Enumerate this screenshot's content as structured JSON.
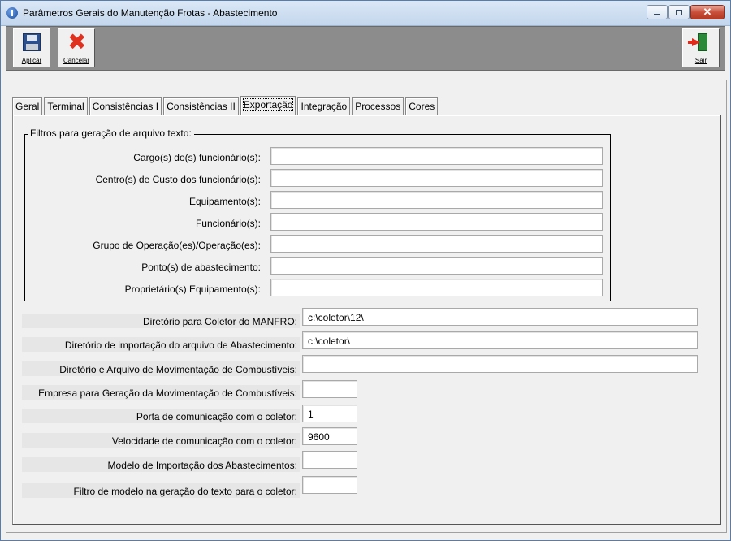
{
  "window": {
    "title": "Parâmetros Gerais do Manutenção Frotas - Abastecimento"
  },
  "toolbar": {
    "apply_label": "Aplicar",
    "cancel_label": "Cancelar",
    "exit_label": "Sair"
  },
  "tabs": [
    {
      "label": "Geral"
    },
    {
      "label": "Terminal"
    },
    {
      "label": "Consistências I"
    },
    {
      "label": "Consistências II"
    },
    {
      "label": "Exportação"
    },
    {
      "label": "Integração"
    },
    {
      "label": "Processos"
    },
    {
      "label": "Cores"
    }
  ],
  "active_tab": "Exportação",
  "filters": {
    "caption": "Filtros para geração de arquivo texto:",
    "rows": [
      {
        "label": "Cargo(s) do(s) funcionário(s):",
        "value": ""
      },
      {
        "label": "Centro(s) de Custo dos funcionário(s):",
        "value": ""
      },
      {
        "label": "Equipamento(s):",
        "value": ""
      },
      {
        "label": "Funcionário(s):",
        "value": ""
      },
      {
        "label": "Grupo de Operação(es)/Operação(es):",
        "value": ""
      },
      {
        "label": "Ponto(s) de abastecimento:",
        "value": ""
      },
      {
        "label": "Proprietário(s) Equipamento(s):",
        "value": ""
      }
    ]
  },
  "settings": [
    {
      "label": "Diretório para Coletor do MANFRO:",
      "value": "c:\\coletor\\12\\"
    },
    {
      "label": "Diretório de importação do arquivo de Abastecimento:",
      "value": "c:\\coletor\\"
    },
    {
      "label": "Diretório e Arquivo de Movimentação de Combustíveis:",
      "value": ""
    },
    {
      "label": "Empresa para Geração da Movimentação de Combustíveis:",
      "value": ""
    },
    {
      "label": "Porta de comunicação com o coletor:",
      "value": "1"
    },
    {
      "label": "Velocidade de comunicação com o coletor:",
      "value": "9600"
    },
    {
      "label": "Modelo de Importação dos Abastecimentos:",
      "value": ""
    },
    {
      "label": "Filtro de modelo na geração do texto para o coletor:",
      "value": ""
    }
  ]
}
